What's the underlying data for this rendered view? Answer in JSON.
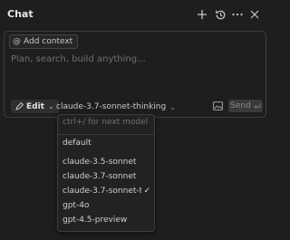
{
  "header": {
    "title": "Chat",
    "icons": [
      "plus-icon",
      "history-icon",
      "more-icon",
      "close-icon"
    ]
  },
  "composer": {
    "add_context_label": "Add context",
    "add_context_symbol": "@",
    "placeholder": "Plan, search, build anything...",
    "value": "",
    "mode_label": "Edit",
    "mode_chevron": "⌄",
    "model_selected": "claude-3.7-sonnet-thinking",
    "model_chevron": "⌄",
    "send_label": "Send"
  },
  "model_dropdown": {
    "search_placeholder": "ctrl+/ for next model",
    "items": [
      {
        "label": "default",
        "checked": ""
      },
      {
        "label": "claude-3.5-sonnet",
        "checked": ""
      },
      {
        "label": "claude-3.7-sonnet",
        "checked": ""
      },
      {
        "label": "claude-3.7-sonnet-t...",
        "checked": "✓"
      },
      {
        "label": "gpt-4o",
        "checked": ""
      },
      {
        "label": "gpt-4.5-preview",
        "checked": ""
      }
    ]
  },
  "colors": {
    "background": "#1e1e1e",
    "panel_border": "#3c3c3c",
    "dropdown_bg": "#222222",
    "text": "#cccccc",
    "muted_text": "#6f6f6f"
  }
}
